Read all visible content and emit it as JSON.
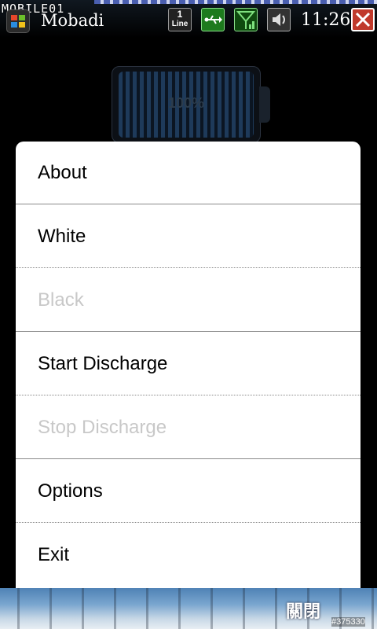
{
  "watermark_top": "MOBILE01",
  "app_title": "Mobadi",
  "status": {
    "line_number": "1",
    "line_label": "Line",
    "icons": [
      "usb-icon",
      "signal-icon",
      "speaker-icon"
    ],
    "time": "11:26"
  },
  "battery": {
    "percent_text": "100%",
    "level": 1.0
  },
  "menu": {
    "items": [
      {
        "label": "About",
        "enabled": true
      },
      {
        "label": "White",
        "enabled": true
      },
      {
        "label": "Black",
        "enabled": false
      },
      {
        "label": "Start Discharge",
        "enabled": true
      },
      {
        "label": "Stop Discharge",
        "enabled": false
      },
      {
        "label": "Options",
        "enabled": true
      },
      {
        "label": "Exit",
        "enabled": true
      }
    ]
  },
  "bottom_bar": {
    "close_label": "關閉"
  },
  "watermark_bottom": "#375330",
  "colors": {
    "close_red": "#c0392b",
    "menu_bg": "#ffffff",
    "disabled_text": "#c8c8c8"
  }
}
